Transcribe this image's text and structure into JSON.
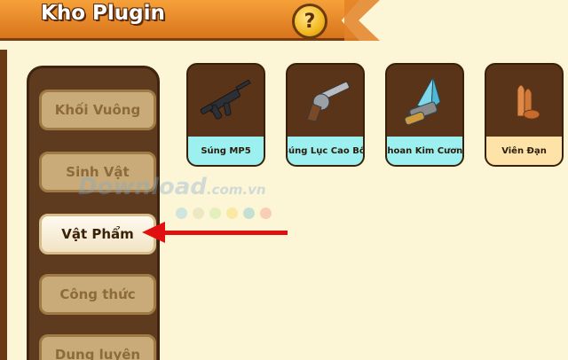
{
  "header": {
    "title": "Kho Plugin",
    "help_label": "?"
  },
  "sidebar": {
    "items": [
      {
        "label": "Khối Vuông",
        "active": false
      },
      {
        "label": "Sinh Vật",
        "active": false
      },
      {
        "label": "Vật Phẩm",
        "active": true
      },
      {
        "label": "Công thức",
        "active": false
      },
      {
        "label": "Dung luyện",
        "active": false
      }
    ]
  },
  "items": [
    {
      "label": "Súng MP5",
      "icon": "smg-icon",
      "label_color": "#9cf0f0"
    },
    {
      "label": "Súng Lục Cao Bồi",
      "icon": "revolver-icon",
      "label_color": "#9cf0f0"
    },
    {
      "label": "Khoan Kim Cương",
      "icon": "diamond-drill-icon",
      "label_color": "#9cf0f0"
    },
    {
      "label": "Viên Đạn",
      "icon": "bullets-icon",
      "label_color": "#fde3a8"
    }
  ],
  "watermark": {
    "text": "Download",
    "domain": ".com.vn"
  },
  "colors": {
    "header": "#e38228",
    "background": "#fdf6d6",
    "sidebar": "#5e3a1e",
    "arrow": "#e01010"
  }
}
